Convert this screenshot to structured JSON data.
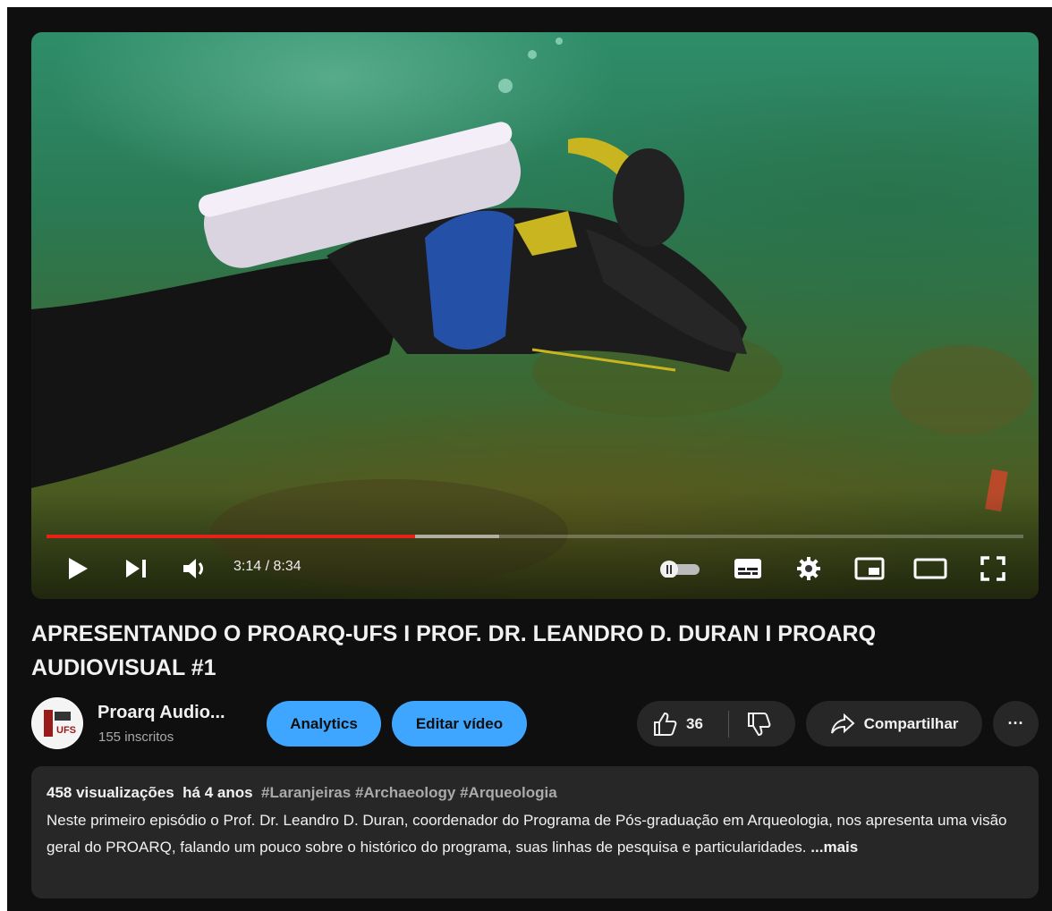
{
  "player": {
    "current_time": "3:14",
    "duration": "8:34",
    "time_display": "3:14 / 8:34",
    "progress_fraction": 0.377,
    "buffer_fraction": 0.463,
    "accent_color": "#e62117",
    "icons": [
      "play-icon",
      "next-icon",
      "volume-icon",
      "autoplay-toggle-icon",
      "subtitles-icon",
      "settings-icon",
      "miniplayer-icon",
      "theater-mode-icon",
      "fullscreen-icon"
    ]
  },
  "video": {
    "title": "APRESENTANDO O PROARQ-UFS I PROF. DR. LEANDRO D. DURAN I PROARQ AUDIOVISUAL #1"
  },
  "channel": {
    "name": "Proarq Audio...",
    "subscribers": "155 inscritos",
    "avatar_text": "UFS"
  },
  "actions": {
    "analytics_label": "Analytics",
    "edit_label": "Editar vídeo",
    "like_count": "36",
    "share_label": "Compartilhar",
    "more_label": "···"
  },
  "description": {
    "views": "458 visualizações",
    "age": "há 4 anos",
    "tags": "#Laranjeiras #Archaeology #Arqueologia",
    "text": "Neste primeiro episódio o Prof. Dr. Leandro D. Duran, coordenador  do Programa de Pós-graduação em Arqueologia, nos apresenta uma visão geral do PROARQ, falando um pouco sobre o histórico do programa, suas linhas de pesquisa e particularidades.",
    "more_label": "...mais"
  }
}
